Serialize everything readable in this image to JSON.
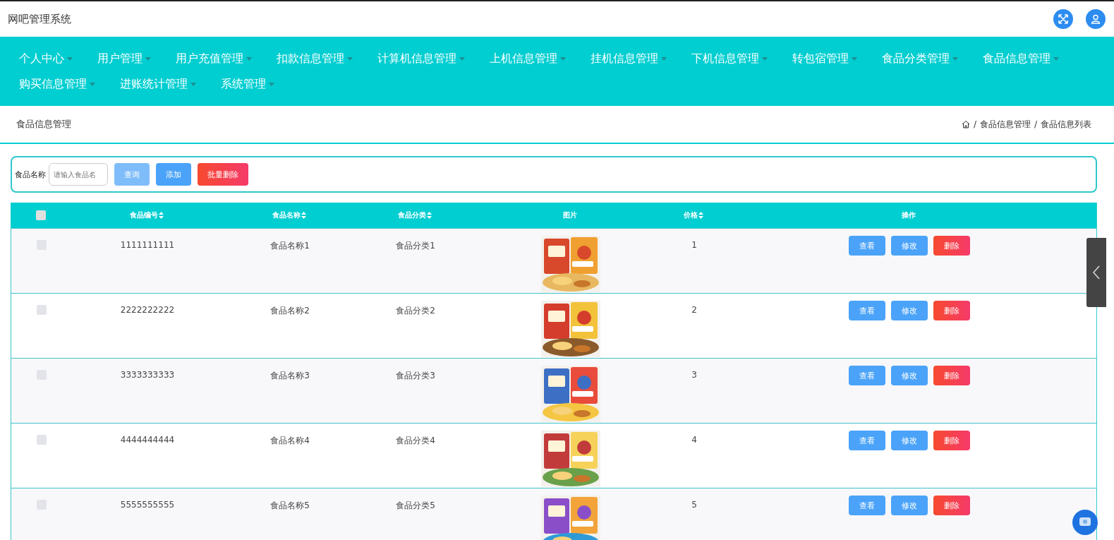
{
  "header": {
    "title": "网吧管理系统"
  },
  "nav": {
    "items": [
      {
        "label": "个人中心"
      },
      {
        "label": "用户管理"
      },
      {
        "label": "用户充值管理"
      },
      {
        "label": "扣款信息管理"
      },
      {
        "label": "计算机信息管理"
      },
      {
        "label": "上机信息管理"
      },
      {
        "label": "挂机信息管理"
      },
      {
        "label": "下机信息管理"
      },
      {
        "label": "转包宿管理"
      },
      {
        "label": "食品分类管理"
      },
      {
        "label": "食品信息管理"
      },
      {
        "label": "购买信息管理"
      },
      {
        "label": "进账统计管理"
      },
      {
        "label": "系统管理"
      }
    ]
  },
  "page": {
    "title": "食品信息管理",
    "breadcrumb": [
      {
        "separator": "/",
        "label": "食品信息管理"
      },
      {
        "separator": "/",
        "label": "食品信息列表"
      }
    ]
  },
  "search": {
    "label": "食品名称",
    "placeholder": "请输入食品名",
    "buttons": [
      {
        "label": "查询",
        "kind": "query"
      },
      {
        "label": "添加",
        "kind": "add"
      },
      {
        "label": "批量删除",
        "kind": "danger"
      }
    ]
  },
  "table": {
    "select_all": {
      "checked": false
    },
    "columns": [
      {
        "label": "食品编号",
        "sortable": true
      },
      {
        "label": "食品名称",
        "sortable": true
      },
      {
        "label": "食品分类",
        "sortable": true
      },
      {
        "label": "图片",
        "sortable": false
      },
      {
        "label": "价格",
        "sortable": true
      },
      {
        "label": "操作",
        "sortable": false
      }
    ],
    "rows": [
      {
        "checked": false,
        "id": "1111111111",
        "name": "食品名称1",
        "category": "食品分类1",
        "price": "1",
        "actions": [
          {
            "label": "查看",
            "kind": "view"
          },
          {
            "label": "修改",
            "kind": "edit"
          },
          {
            "label": "删除",
            "kind": "delete"
          }
        ]
      },
      {
        "checked": false,
        "id": "2222222222",
        "name": "食品名称2",
        "category": "食品分类2",
        "price": "2",
        "actions": [
          {
            "label": "查看",
            "kind": "view"
          },
          {
            "label": "修改",
            "kind": "edit"
          },
          {
            "label": "删除",
            "kind": "delete"
          }
        ]
      },
      {
        "checked": false,
        "id": "3333333333",
        "name": "食品名称3",
        "category": "食品分类3",
        "price": "3",
        "actions": [
          {
            "label": "查看",
            "kind": "view"
          },
          {
            "label": "修改",
            "kind": "edit"
          },
          {
            "label": "删除",
            "kind": "delete"
          }
        ]
      },
      {
        "checked": false,
        "id": "4444444444",
        "name": "食品名称4",
        "category": "食品分类4",
        "price": "4",
        "actions": [
          {
            "label": "查看",
            "kind": "view"
          },
          {
            "label": "修改",
            "kind": "edit"
          },
          {
            "label": "删除",
            "kind": "delete"
          }
        ]
      },
      {
        "checked": false,
        "id": "5555555555",
        "name": "食品名称5",
        "category": "食品分类5",
        "price": "5",
        "actions": [
          {
            "label": "查看",
            "kind": "view"
          },
          {
            "label": "修改",
            "kind": "edit"
          },
          {
            "label": "删除",
            "kind": "delete"
          }
        ]
      }
    ]
  }
}
